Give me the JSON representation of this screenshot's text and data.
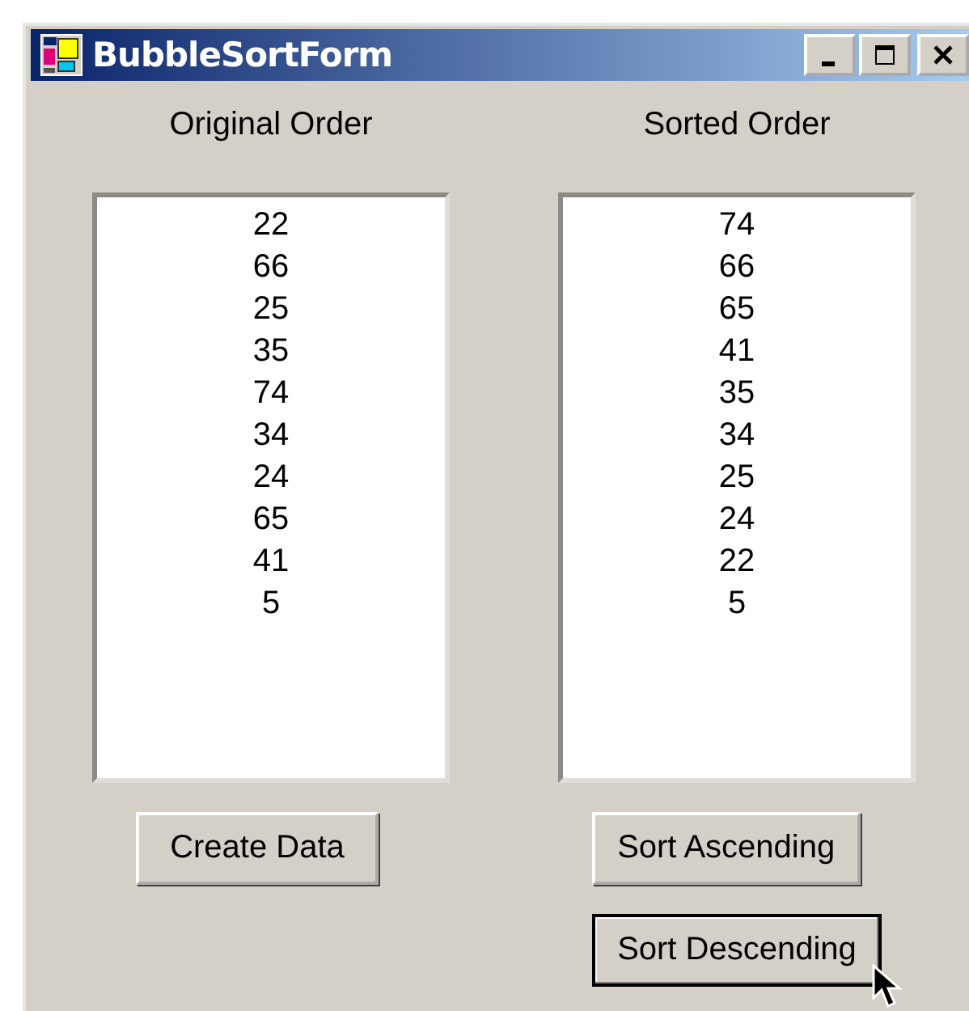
{
  "window": {
    "title": "BubbleSortForm"
  },
  "lists": [
    {
      "label": "Original Order",
      "items": [
        "22",
        "66",
        "25",
        "35",
        "74",
        "34",
        "24",
        "65",
        "41",
        "5"
      ],
      "buttons": [
        {
          "label": "Create Data",
          "focused": false
        }
      ]
    },
    {
      "label": "Sorted Order",
      "items": [
        "74",
        "66",
        "65",
        "41",
        "35",
        "34",
        "25",
        "24",
        "22",
        "5"
      ],
      "buttons": [
        {
          "label": "Sort Ascending",
          "focused": false
        },
        {
          "label": "Sort Descending",
          "focused": true
        }
      ]
    }
  ]
}
